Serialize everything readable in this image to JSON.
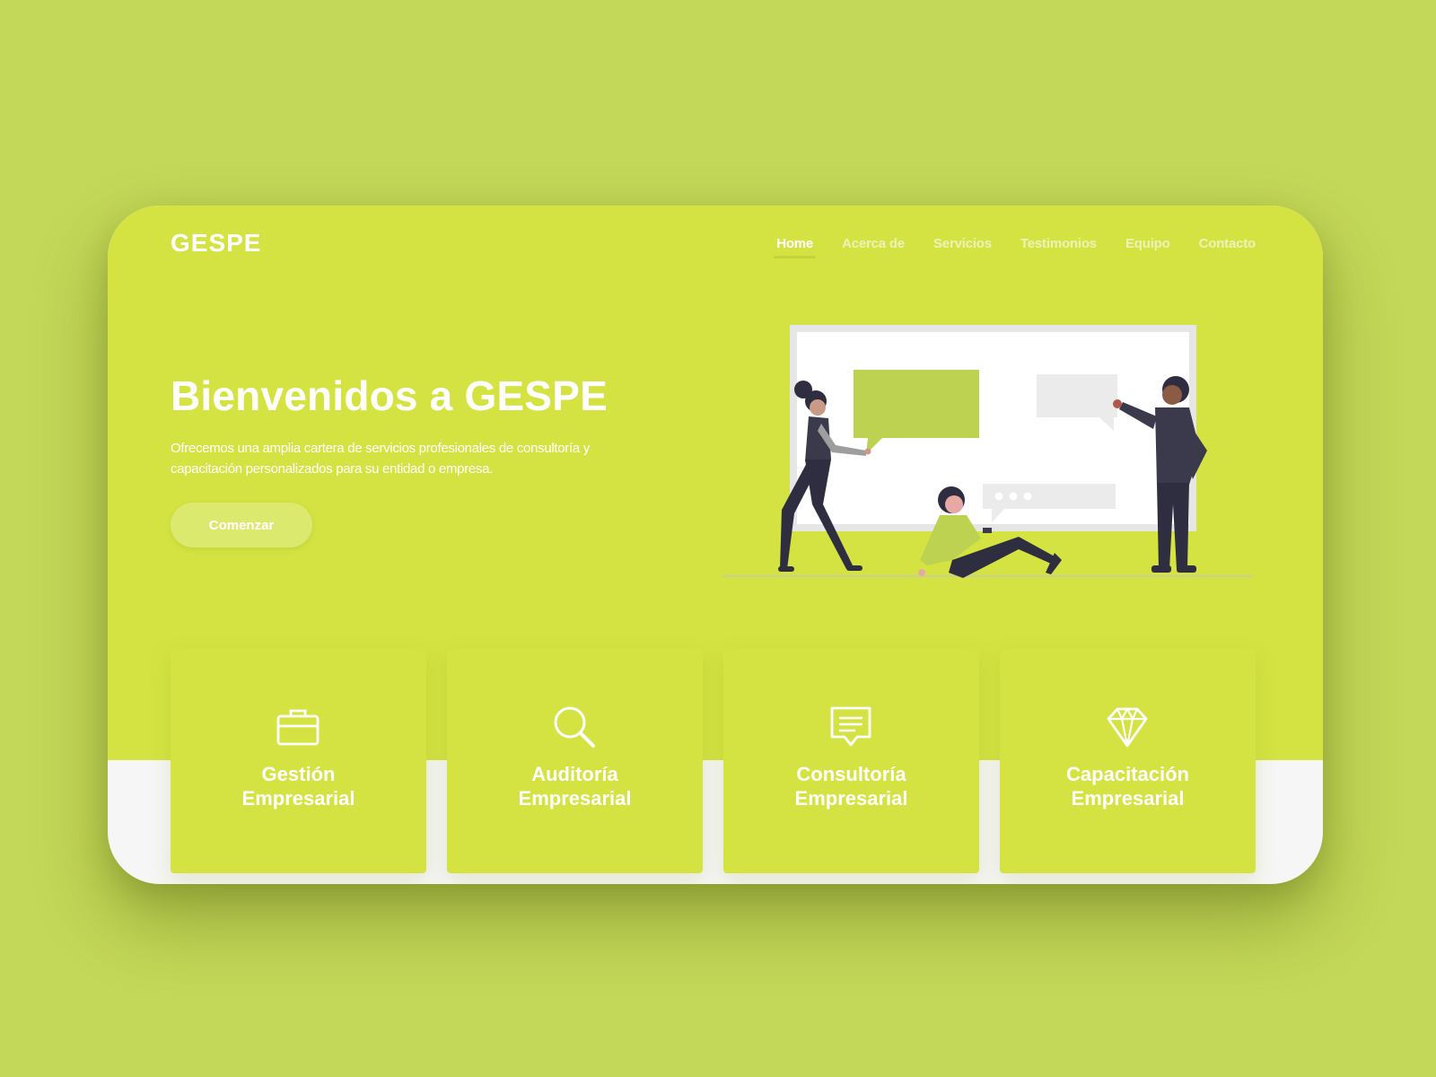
{
  "brand": {
    "name": "GESPE"
  },
  "nav": {
    "items": [
      {
        "label": "Home",
        "active": true
      },
      {
        "label": "Acerca de",
        "active": false
      },
      {
        "label": "Servicios",
        "active": false
      },
      {
        "label": "Testimonios",
        "active": false
      },
      {
        "label": "Equipo",
        "active": false
      },
      {
        "label": "Contacto",
        "active": false
      }
    ]
  },
  "hero": {
    "title": "Bienvenidos a GESPE",
    "description": "Ofrecemos una amplia cartera de servicios profesionales de consultoría y capacitación personalizados para su entidad o empresa.",
    "cta_label": "Comenzar",
    "illustration_icon": "presentation-team-illustration"
  },
  "services": [
    {
      "line1": "Gestión",
      "line2": "Empresarial",
      "icon": "briefcase-icon"
    },
    {
      "line1": "Auditoría",
      "line2": "Empresarial",
      "icon": "search-icon"
    },
    {
      "line1": "Consultoría",
      "line2": "Empresarial",
      "icon": "chat-icon"
    },
    {
      "line1": "Capacitación",
      "line2": "Empresarial",
      "icon": "diamond-icon"
    }
  ],
  "colors": {
    "page_background": "#c3d758",
    "accent": "#d4e342",
    "button_fill": "#dbe96e",
    "figure_dark": "#3b3a4d",
    "white": "#ffffff"
  }
}
